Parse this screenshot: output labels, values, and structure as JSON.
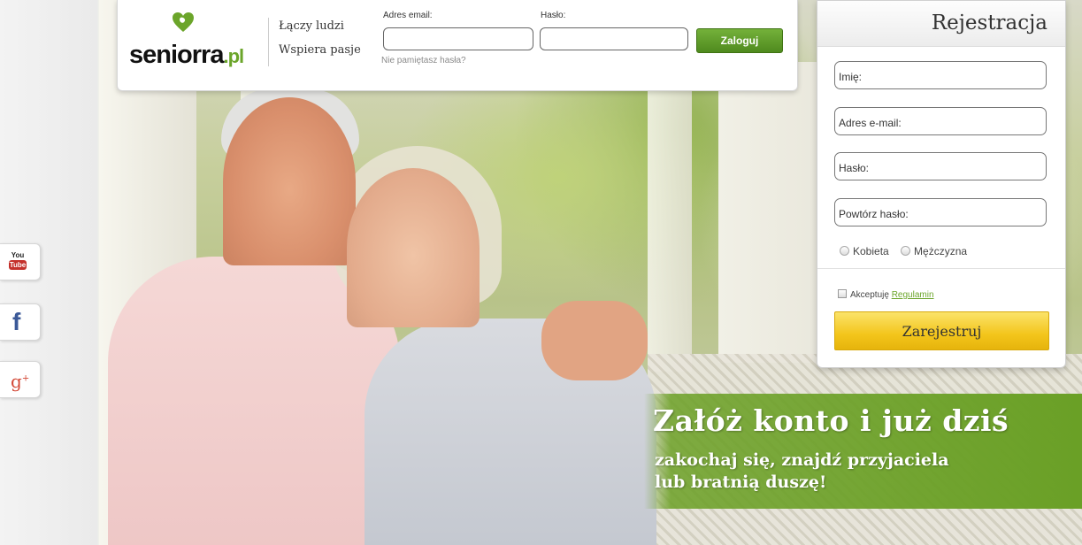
{
  "brand": {
    "name": "seniorra",
    "tld": ".pl",
    "accent": "#6ba52a"
  },
  "header": {
    "tagline_1": "Łączy ludzi",
    "tagline_2": "Wspiera pasje",
    "email_label": "Adres email:",
    "email_value": "",
    "password_label": "Hasło:",
    "password_value": "",
    "forgot_link": "Nie pamiętasz hasła?",
    "login_button": "Zaloguj"
  },
  "registration": {
    "title": "Rejestracja",
    "first_name_placeholder": "Imię:",
    "email_placeholder": "Adres e-mail:",
    "password_placeholder": "Hasło:",
    "repeat_password_placeholder": "Powtórz hasło:",
    "gender_options": [
      "Kobieta",
      "Mężczyzna"
    ],
    "accept_text": "Akceptuję",
    "terms_link": "Regulamin",
    "submit_button": "Zarejestruj",
    "button_color": "#f3c51b"
  },
  "promo": {
    "headline": "Załóż konto i już dziś",
    "line_1": "zakochaj się, znajdź przyjaciela",
    "line_2": "lub bratnią duszę!",
    "color": "#6aa026"
  },
  "social": {
    "youtube": {
      "icon": "youtube-icon",
      "text_top": "You",
      "text_bottom": "Tube"
    },
    "facebook": {
      "icon": "facebook-icon",
      "glyph": "f"
    },
    "googleplus": {
      "icon": "google-plus-icon",
      "glyph": "g",
      "plus": "+"
    }
  }
}
